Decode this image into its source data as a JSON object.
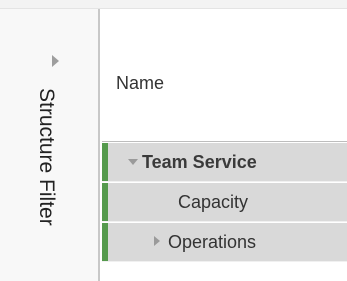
{
  "filter_panel": {
    "title": "Structure Filter",
    "collapse_icon": "chevron-right-icon"
  },
  "grid": {
    "column_header": "Name",
    "rows": [
      {
        "label": "Team Service",
        "expanded": true,
        "bold": true,
        "icon": "caret-down-icon"
      },
      {
        "label": "Capacity",
        "bold": false
      },
      {
        "label": "Operations",
        "expanded": false,
        "bold": false,
        "icon": "caret-right-icon"
      }
    ]
  },
  "colors": {
    "accent": "#559a4d",
    "row_background": "#d9d9d9",
    "panel_background": "#f8f8f8"
  }
}
